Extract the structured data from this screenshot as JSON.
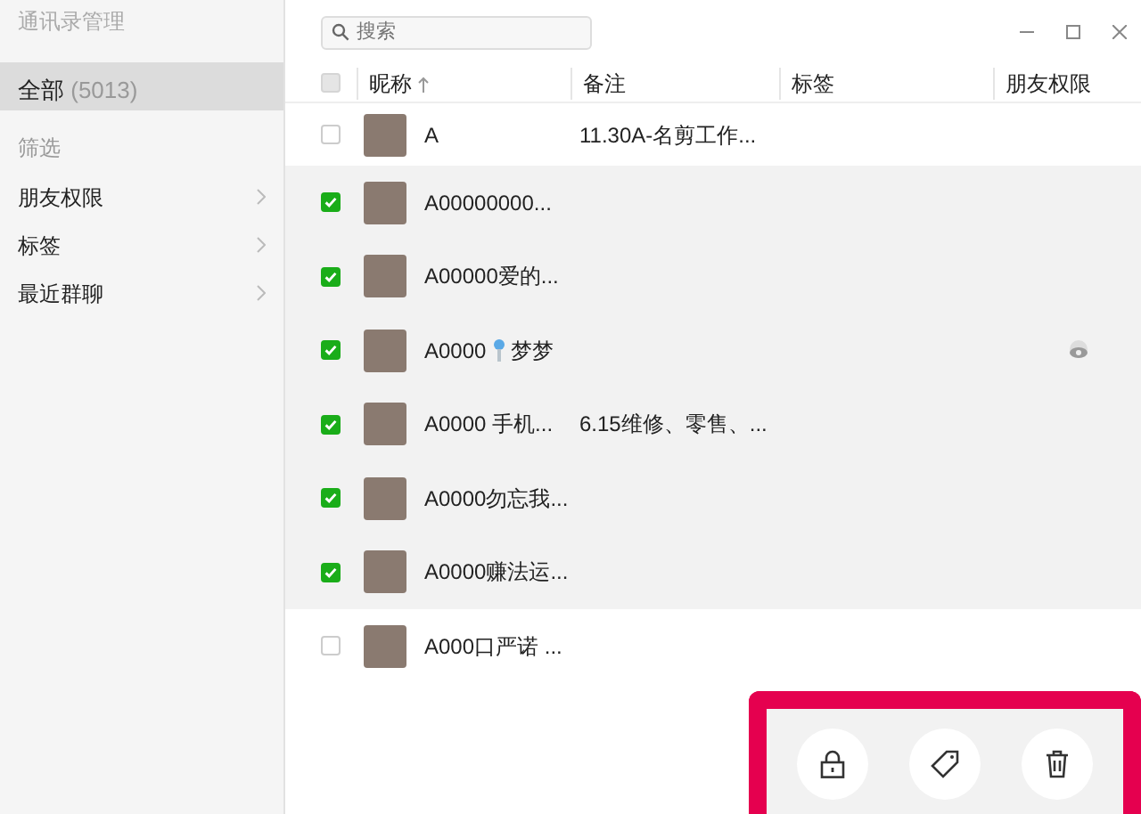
{
  "sidebar": {
    "title": "通讯录管理",
    "items": [
      {
        "label": "全部",
        "count": "(5013)",
        "selected": true
      }
    ],
    "filter_label": "筛选",
    "filters": [
      {
        "label": "朋友权限"
      },
      {
        "label": "标签"
      },
      {
        "label": "最近群聊"
      }
    ]
  },
  "search": {
    "placeholder": "搜索"
  },
  "table": {
    "select_all_checked": false,
    "columns": [
      {
        "label": "昵称",
        "sorted": true
      },
      {
        "label": "备注",
        "sorted": false
      },
      {
        "label": "标签",
        "sorted": false
      },
      {
        "label": "朋友权限",
        "sorted": false
      }
    ],
    "rows": [
      {
        "checked": false,
        "name": "A",
        "remark": "11.30A-名剪工作..."
      },
      {
        "checked": true,
        "name": "A00000000..."
      },
      {
        "checked": true,
        "name": "A00000爱的..."
      },
      {
        "checked": true,
        "name": "A0000",
        "key_icon": true,
        "name_suffix": "梦梦",
        "permission_icon": true
      },
      {
        "checked": true,
        "name": "A0000  手机...",
        "remark": "6.15维修、零售、..."
      },
      {
        "checked": true,
        "name": "A0000勿忘我..."
      },
      {
        "checked": true,
        "name": "A0000赚法运..."
      },
      {
        "checked": false,
        "name": "A000口严诺  ..."
      }
    ]
  },
  "actions": [
    {
      "kind": "lock"
    },
    {
      "kind": "tag"
    },
    {
      "kind": "delete"
    }
  ]
}
